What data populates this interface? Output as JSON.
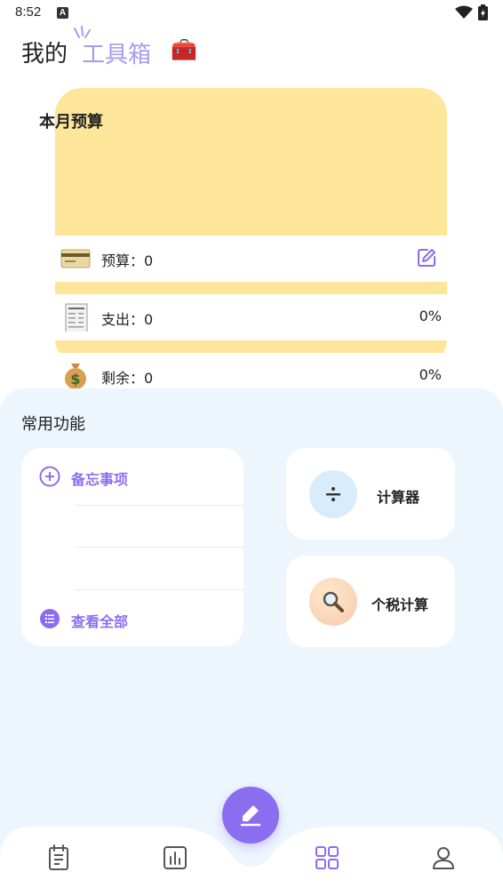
{
  "status_bar": {
    "time": "8:52",
    "notification_letter": "A"
  },
  "header": {
    "title_main": "我的",
    "title_sub": "工具箱",
    "toolbox_emoji": "🧰"
  },
  "budget": {
    "title": "本月预算",
    "rows": [
      {
        "icon": "credit-card",
        "emoji": "💳",
        "label": "预算：0",
        "percent": ""
      },
      {
        "icon": "receipt",
        "emoji": "🧾",
        "label": "支出：0",
        "percent": "0%"
      },
      {
        "icon": "money-bag",
        "emoji": "💰",
        "label": "剩余：0",
        "percent": "0%"
      }
    ]
  },
  "features": {
    "section_title": "常用功能",
    "memo": {
      "add_label": "备忘事项",
      "view_all_label": "查看全部"
    },
    "tools": [
      {
        "label": "计算器",
        "icon": "divide",
        "glyph": "÷",
        "color": "#d8ecfb"
      },
      {
        "label": "个税计算",
        "icon": "magnifier",
        "glyph": "🔍",
        "color": "#fde0c9"
      }
    ]
  },
  "bottom_nav": {
    "items": [
      {
        "icon": "clipboard-list",
        "active": false
      },
      {
        "icon": "bar-chart",
        "active": false
      },
      {
        "icon": "grid",
        "active": true
      },
      {
        "icon": "person",
        "active": false
      }
    ]
  },
  "colors": {
    "accent": "#8b6ef0",
    "budget_bg": "#fde69a",
    "panel_bg": "#edf5fd"
  }
}
